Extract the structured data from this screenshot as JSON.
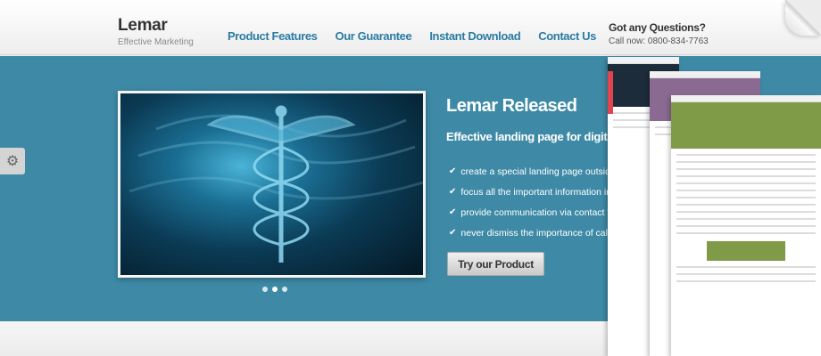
{
  "header": {
    "logo": "Lemar",
    "tagline": "Effective Marketing",
    "nav": [
      {
        "label": "Product Features"
      },
      {
        "label": "Our Guarantee"
      },
      {
        "label": "Instant Download"
      },
      {
        "label": "Contact Us"
      }
    ],
    "contact_question": "Got any Questions?",
    "contact_phone": "Call now: 0800-834-7763"
  },
  "banner": {
    "title": "Lemar Released",
    "subtitle": "Effective landing page for digital sa",
    "features": [
      "create a special landing page outside of you",
      "focus all the important information in one s",
      "provide communication via contact form and",
      "never dismiss the importance of call to actio"
    ],
    "cta_label": "Try our Product",
    "slider_dots": 3,
    "active_dot": 1
  },
  "icons": {
    "settings": "gear-icon",
    "feature_bullet": "checkmark-icon"
  },
  "colors": {
    "banner_bg": "#3e8aa6",
    "nav_link": "#2a7ca3",
    "mock_green": "#7f9b48",
    "mock_purple": "#8a6a91",
    "mock_red": "#e0454f"
  }
}
